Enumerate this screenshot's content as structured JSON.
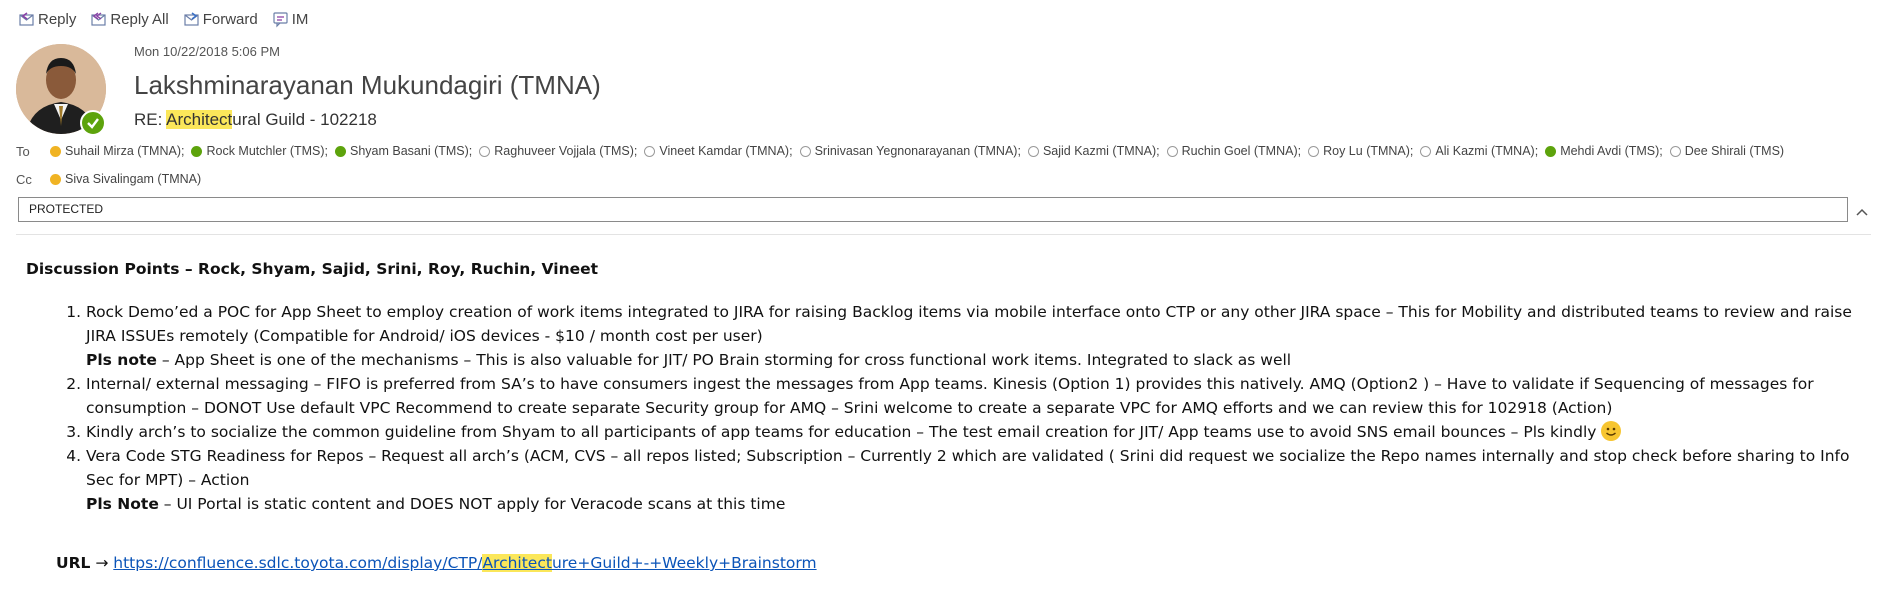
{
  "toolbar": {
    "reply_label": "Reply",
    "reply_all_label": "Reply All",
    "forward_label": "Forward",
    "im_label": "IM"
  },
  "header": {
    "date": "Mon 10/22/2018 5:06 PM",
    "sender": "Lakshminarayanan Mukundagiri (TMNA)",
    "subject_prefix": "RE: ",
    "subject_highlight": "Architect",
    "subject_rest": "ural Guild - 102218",
    "to_label": "To",
    "cc_label": "Cc",
    "to": [
      {
        "name": "Suhail Mirza (TMNA);",
        "status": "away"
      },
      {
        "name": "Rock Mutchler (TMS);",
        "status": "available"
      },
      {
        "name": "Shyam Basani (TMS);",
        "status": "available"
      },
      {
        "name": "Raghuveer Vojjala (TMS);",
        "status": "offline"
      },
      {
        "name": "Vineet Kamdar (TMNA);",
        "status": "offline"
      },
      {
        "name": "Srinivasan Yegnonarayanan (TMNA);",
        "status": "offline"
      },
      {
        "name": "Sajid Kazmi (TMNA);",
        "status": "offline"
      },
      {
        "name": "Ruchin Goel (TMNA);",
        "status": "offline"
      },
      {
        "name": "Roy Lu (TMNA);",
        "status": "offline"
      },
      {
        "name": "Ali Kazmi (TMNA);",
        "status": "offline"
      },
      {
        "name": "Mehdi Avdi (TMS);",
        "status": "available"
      },
      {
        "name": "Dee Shirali (TMS)",
        "status": "offline"
      }
    ],
    "cc": [
      {
        "name": "Siva Sivalingam (TMNA)",
        "status": "away"
      }
    ],
    "classification": "PROTECTED"
  },
  "body": {
    "heading": "Discussion Points – Rock, Shyam, Sajid, Srini, Roy, Ruchin, Vineet",
    "items": [
      {
        "text": "Rock Demo’ed a POC for App Sheet to employ creation of work items integrated to JIRA for raising Backlog items via mobile interface onto CTP or any other JIRA space – This for Mobility and distributed teams to review and raise JIRA ISSUEs remotely (Compatible for Android/ iOS devices - $10 / month cost per user)",
        "note_label": "Pls note",
        "note": " – App Sheet is one of the mechanisms – This is also valuable for JIT/ PO Brain storming for cross functional work items. Integrated to slack as well"
      },
      {
        "text": "Internal/ external messaging – FIFO is preferred from SA’s to have consumers ingest the messages from App teams. Kinesis (Option 1) provides this natively. AMQ (Option2 ) – Have to validate if Sequencing of messages for consumption – DONOT Use default VPC Recommend to create separate Security group for AMQ – Srini welcome to create a separate VPC for AMQ efforts and we can review this for 102918 (Action)"
      },
      {
        "text": "Kindly arch’s to socialize the common guideline from Shyam to all participants of app teams for education – The test email creation for JIT/ App teams use to avoid SNS email bounces – Pls kindly"
      },
      {
        "text": "Vera Code STG Readiness for Repos – Request all arch’s (ACM, CVS – all repos listed; Subscription – Currently 2 which are validated ( Srini did request we socialize the Repo names internally and stop check before sharing to Info Sec for MPT) – Action",
        "note_label": "Pls Note",
        "note": " – UI Portal is static content and DOES NOT apply for Veracode scans at this time"
      }
    ],
    "url_label": "URL",
    "url_arrow": "→",
    "url_prefix": "https://confluence.sdlc.toyota.com/display/CTP/",
    "url_highlight": "Architect",
    "url_rest": "ure+Guild+-+Weekly+Brainstorm"
  },
  "colors": {
    "available": "#5da30c",
    "away": "#f0b323",
    "offline": "#9a9a9a",
    "highlight": "#fbe75a",
    "link": "#0b54b8"
  }
}
